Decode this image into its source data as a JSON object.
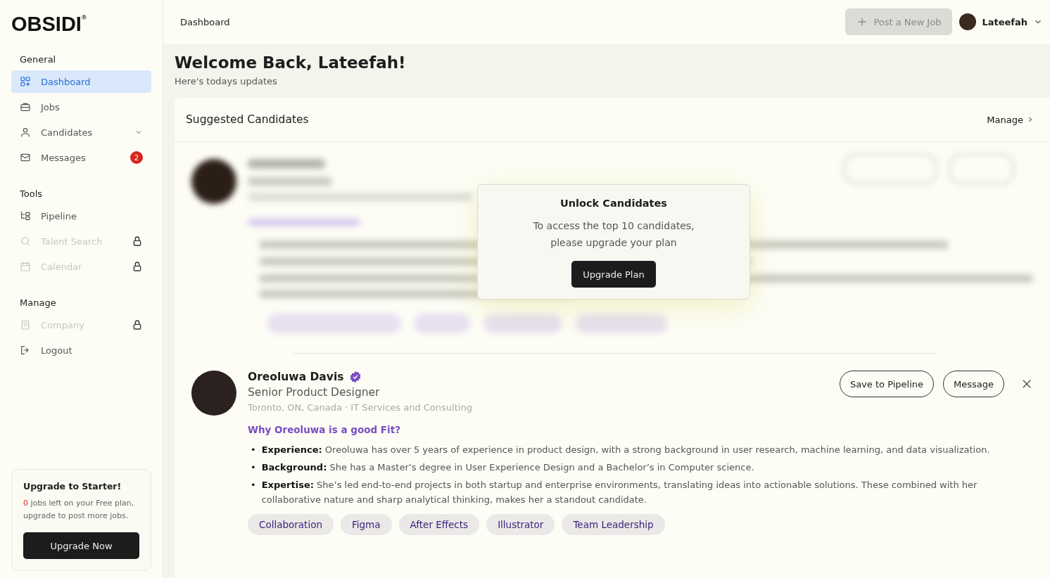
{
  "logo": {
    "text": "OBSIDI",
    "mark": "®"
  },
  "sidebar": {
    "sections": [
      {
        "title": "General",
        "items": [
          {
            "label": "Dashboard",
            "selected": true,
            "disabled": false,
            "locked": false,
            "kind": "link"
          },
          {
            "label": "Jobs",
            "selected": false,
            "disabled": false,
            "locked": false,
            "kind": "link"
          },
          {
            "label": "Candidates",
            "selected": false,
            "disabled": false,
            "locked": false,
            "kind": "group"
          },
          {
            "label": "Messages",
            "selected": false,
            "disabled": false,
            "locked": false,
            "kind": "link",
            "badge": "2"
          }
        ]
      },
      {
        "title": "Tools",
        "items": [
          {
            "label": "Pipeline",
            "selected": false,
            "disabled": false,
            "locked": false,
            "kind": "link"
          },
          {
            "label": "Talent Search",
            "selected": false,
            "disabled": true,
            "locked": true,
            "kind": "link"
          },
          {
            "label": "Calendar",
            "selected": false,
            "disabled": true,
            "locked": true,
            "kind": "link"
          }
        ]
      },
      {
        "title": "Manage",
        "items": [
          {
            "label": "Company",
            "selected": false,
            "disabled": true,
            "locked": true,
            "kind": "link"
          },
          {
            "label": "Logout",
            "selected": false,
            "disabled": false,
            "locked": false,
            "kind": "link"
          }
        ]
      }
    ],
    "upgrade": {
      "title": "Upgrade to Starter!",
      "count": "0",
      "text": "jobs left on your Free plan, upgrade  to post more jobs.",
      "button": "Upgrade Now"
    }
  },
  "topbar": {
    "breadcrumb": "Dashboard",
    "post_button": {
      "label": "Post a New Job",
      "disabled": true
    },
    "user": "Lateefah"
  },
  "header": {
    "title": "Welcome Back, Lateefah!",
    "subtitle": "Here's todays updates"
  },
  "suggested": {
    "title": "Suggested Candidates",
    "manage": "Manage",
    "lock_dialog": {
      "title": "Unlock Candidates",
      "text": "To access the top 10 candidates, please upgrade your plan",
      "button": "Upgrade Plan"
    },
    "candidate": {
      "name": "Oreoluwa Davis",
      "verified": true,
      "role": "Senior Product Designer",
      "location": "Toronto, ON, Canada · IT Services and Consulting",
      "fit_title": "Why Oreoluwa is a good Fit?",
      "bullet": "•",
      "points": [
        "**Experience:** Oreoluwa has over 5 years of experience in product design, with a strong background in user research, machine learning, and data visualization.",
        "**Background:** She has a Master’s degree in User Experience Design and a Bachelor’s in Computer science.",
        "**Expertise:** She’s led end-to-end projects in both startup and enterprise environments, translating ideas into actionable solutions. These combined with her collaborative nature and sharp analytical thinking, makes her a standout candidate."
      ],
      "skills": [
        "Collaboration",
        "Figma",
        "After Effects",
        "Illustrator",
        "Team Leadership"
      ],
      "actions": [
        "Save to Pipeline",
        "Message"
      ]
    }
  }
}
